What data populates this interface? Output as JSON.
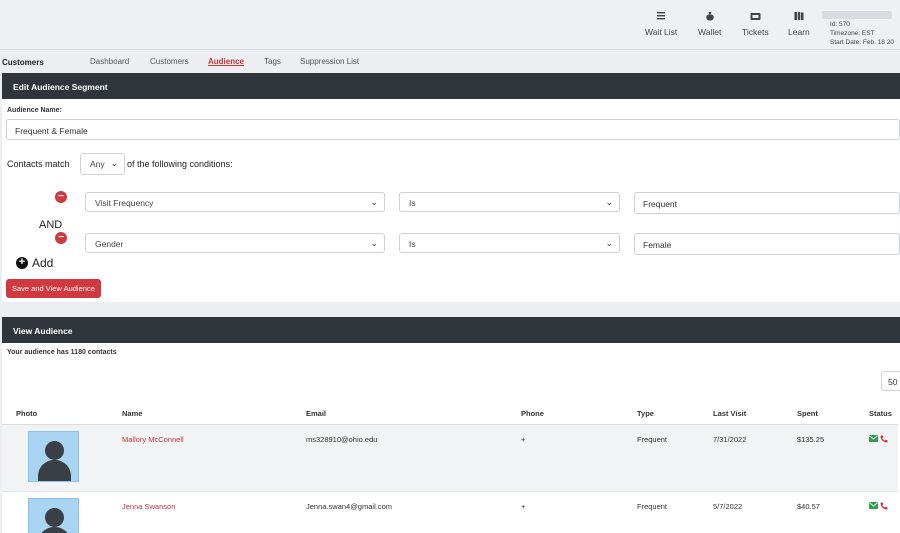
{
  "topnav": {
    "items": [
      {
        "label": "Wait List",
        "icon": "list-icon"
      },
      {
        "label": "Wallet",
        "icon": "money-bag-icon"
      },
      {
        "label": "Tickets",
        "icon": "ticket-icon"
      },
      {
        "label": "Learn",
        "icon": "book-icon"
      }
    ],
    "account": {
      "id": "Id: 570",
      "timezone": "Timezone: EST",
      "start_date": "Start Date: Feb. 18 20"
    }
  },
  "subnav": {
    "brand": "Customers",
    "tabs": [
      "Dashboard",
      "Customers",
      "Audience",
      "Tags",
      "Suppression List"
    ],
    "active": "Audience"
  },
  "edit_panel": {
    "title": "Edit Audience Segment",
    "name_label": "Audience Name:",
    "name_value": "Frequent & Female",
    "match_prefix": "Contacts match",
    "match_value": "Any",
    "match_suffix": "of the following conditions:",
    "conditions": [
      {
        "field": "Visit Frequency",
        "operator": "Is",
        "value": "Frequent"
      },
      {
        "field": "Gender",
        "operator": "Is",
        "value": "Female"
      }
    ],
    "joiner": "AND",
    "add_label": "Add",
    "save_label": "Save and View Audience",
    "remove_symbol": "−"
  },
  "view_panel": {
    "title": "View Audience",
    "summary": "Your audience has 1180 contacts",
    "page_size": "50",
    "columns": [
      "Photo",
      "Name",
      "Email",
      "Phone",
      "Type",
      "Last Visit",
      "Spent",
      "Status"
    ],
    "rows": [
      {
        "name": "Mallory McConnell",
        "email": "ms328910@ohio.edu",
        "phone": "+",
        "type": "Frequent",
        "last_visit": "7/31/2022",
        "spent": "$135.25"
      },
      {
        "name": "Jenna Swanson",
        "email": "Jenna.swan4@gmail.com",
        "phone": "+",
        "type": "Frequent",
        "last_visit": "5/7/2022",
        "spent": "$40.57"
      }
    ]
  },
  "colors": {
    "accent_red": "#c8353b",
    "header_dark": "#30353b",
    "status_green": "#2e9c4a"
  }
}
